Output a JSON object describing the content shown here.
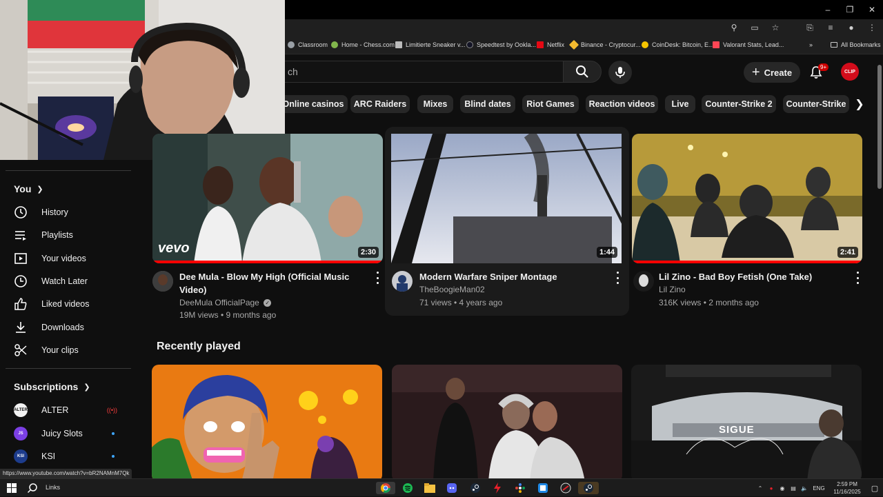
{
  "bookmarks": [
    {
      "label": "Classroom",
      "color": "#9aa0a6"
    },
    {
      "label": "Home - Chess.com",
      "color": "#81b64c"
    },
    {
      "label": "Limitierte Sneaker v...",
      "color": "#bbbbbb"
    },
    {
      "label": "Speedtest by Ookla...",
      "color": "#141526"
    },
    {
      "label": "Netflix",
      "color": "#e50914"
    },
    {
      "label": "Binance - Cryptocur...",
      "color": "#f3ba2f"
    },
    {
      "label": "CoinDesk: Bitcoin, E...",
      "color": "#f5c400"
    },
    {
      "label": "Valorant Stats, Lead...",
      "color": "#ff4655"
    }
  ],
  "all_bookmarks": "All Bookmarks",
  "header": {
    "search_placeholder": "ch",
    "create_label": "Create",
    "notif_badge": "9+",
    "avatar_text": "CLIP"
  },
  "chips": [
    "Online casinos",
    "ARC Raiders",
    "Mixes",
    "Blind dates",
    "Riot Games",
    "Reaction videos",
    "Live",
    "Counter-Strike 2",
    "Counter-Strike"
  ],
  "sidebar": {
    "you_label": "You",
    "items": [
      {
        "label": "History",
        "icon": "history-icon"
      },
      {
        "label": "Playlists",
        "icon": "playlists-icon"
      },
      {
        "label": "Your videos",
        "icon": "your-videos-icon"
      },
      {
        "label": "Watch Later",
        "icon": "watch-later-icon"
      },
      {
        "label": "Liked videos",
        "icon": "liked-icon"
      },
      {
        "label": "Downloads",
        "icon": "download-icon"
      },
      {
        "label": "Your clips",
        "icon": "scissors-icon"
      }
    ],
    "subscriptions_label": "Subscriptions",
    "subscriptions": [
      {
        "name": "ALTER",
        "avatar": "ALTER",
        "color": "#ffffff",
        "live": true
      },
      {
        "name": "Juicy Slots",
        "avatar": "JS",
        "color": "#7b3fe4",
        "live": false
      },
      {
        "name": "KSI",
        "avatar": "KSI",
        "color": "#1d3c8c",
        "live": false
      }
    ]
  },
  "videos": [
    {
      "title_line1": "Dee Mula - Blow My High (Official Music",
      "title_line2": "Video)",
      "channel": "DeeMula OfficialPage",
      "meta": "19M views • 9 months ago",
      "duration": "2:30",
      "verified": true,
      "progress": 1.0,
      "thumb_badge": "vevo"
    },
    {
      "title_line1": "Modern Warfare Sniper Montage",
      "title_line2": "",
      "channel": "TheBoogieMan02",
      "meta": "71 views • 4 years ago",
      "duration": "1:44",
      "verified": false,
      "progress": 0
    },
    {
      "title_line1": "Lil Zino - Bad Boy Fetish (One Take)",
      "title_line2": "",
      "channel": "Lil Zino",
      "meta": "316K views • 2 months ago",
      "duration": "2:41",
      "verified": false,
      "progress": 1.0
    }
  ],
  "recently_played": "Recently played",
  "recent_thumb_text": "SIGUE",
  "status_url": "https://www.youtube.com/watch?v=bR2NAMnM7Qk",
  "taskbar": {
    "search_label": "Links",
    "lang": "ENG",
    "time": "2:59 PM",
    "date": "11/16/2025"
  }
}
